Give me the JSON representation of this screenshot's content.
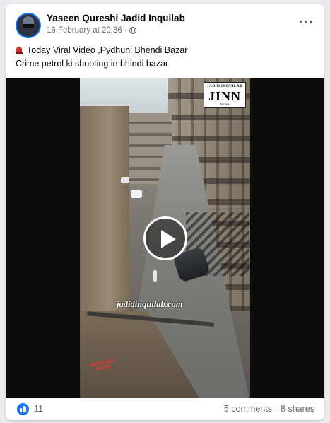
{
  "post": {
    "author": "Yaseen Qureshi Jadid Inquilab",
    "timestamp": "16 February at 20:36",
    "separator": "·",
    "audience_icon": "globe-icon",
    "more_icon": "more-options-icon",
    "text_line_1": "Today Viral Video ,Pydhuni Bhendi Bazar",
    "text_line_1_emoji": "siren-icon",
    "text_line_2": "Crime petrol ki shooting in bhindi bazar"
  },
  "video": {
    "logo_top": "JADID INQUILAB",
    "logo_main": "JINN",
    "logo_bottom": "NEWS",
    "watermark": "jadidinquilab.com",
    "breaking_line_1": "BREAKING",
    "breaking_line_2": "NEWS",
    "play_icon": "play-icon"
  },
  "stats": {
    "reaction_icon": "like-icon",
    "like_count": "11",
    "comments": "5 comments",
    "shares": "8 shares"
  },
  "colors": {
    "accent": "#1877f2",
    "secondary_text": "#65676b",
    "background": "#e9ebee"
  }
}
